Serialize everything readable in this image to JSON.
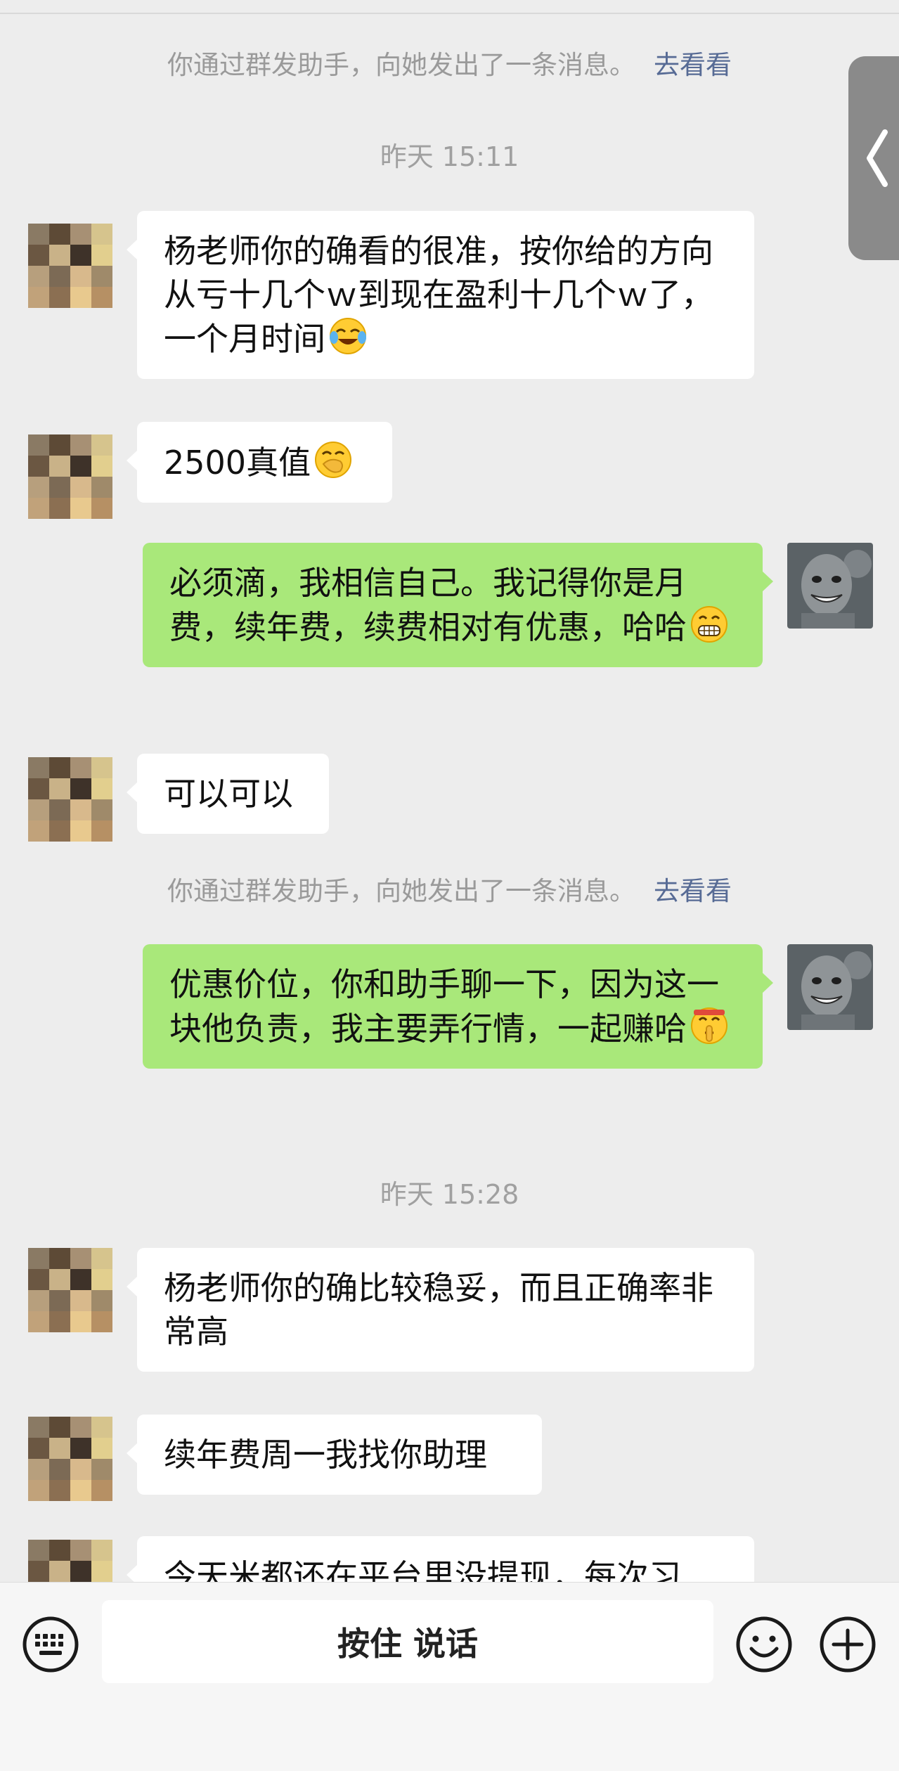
{
  "system": {
    "broadcast_text": "你通过群发助手，向她发出了一条消息。",
    "broadcast_link": "去看看"
  },
  "timestamps": [
    "昨天 15:11",
    "昨天 15:28"
  ],
  "messages": [
    {
      "side": "in",
      "text": "杨老师你的确看的很准，按你给的方向从亏十几个ｗ到现在盈利十几个ｗ了，一个月时间",
      "emoji": "crying-laughing-emoji"
    },
    {
      "side": "in",
      "text": "2500真值",
      "emoji": "hand-over-mouth-emoji"
    },
    {
      "side": "out",
      "text": "必须滴，我相信自己。我记得你是月费，续年费，续费相对有优惠，哈哈",
      "emoji": "grinning-emoji"
    },
    {
      "side": "in",
      "text": "可以可以"
    },
    {
      "side": "out",
      "text": "优惠价位，你和助手聊一下，因为这一块他负责，我主要弄行情，一起赚哈",
      "emoji": "shushing-emoji"
    },
    {
      "side": "in",
      "text": "杨老师你的确比较稳妥，而且正确率非常高"
    },
    {
      "side": "in",
      "text": "续年费周一我找你助理"
    },
    {
      "side": "in",
      "text": "今天米都还在平台里没提现，每次习"
    }
  ],
  "input_bar": {
    "hold_to_talk": "按住 说话",
    "left_icon": "keyboard-icon",
    "emoji_icon": "smiley-icon",
    "plus_icon": "plus-icon"
  },
  "colors": {
    "background": "#ededed",
    "incoming_bubble": "#ffffff",
    "outgoing_bubble": "#a9e87a",
    "link": "#576b95"
  }
}
